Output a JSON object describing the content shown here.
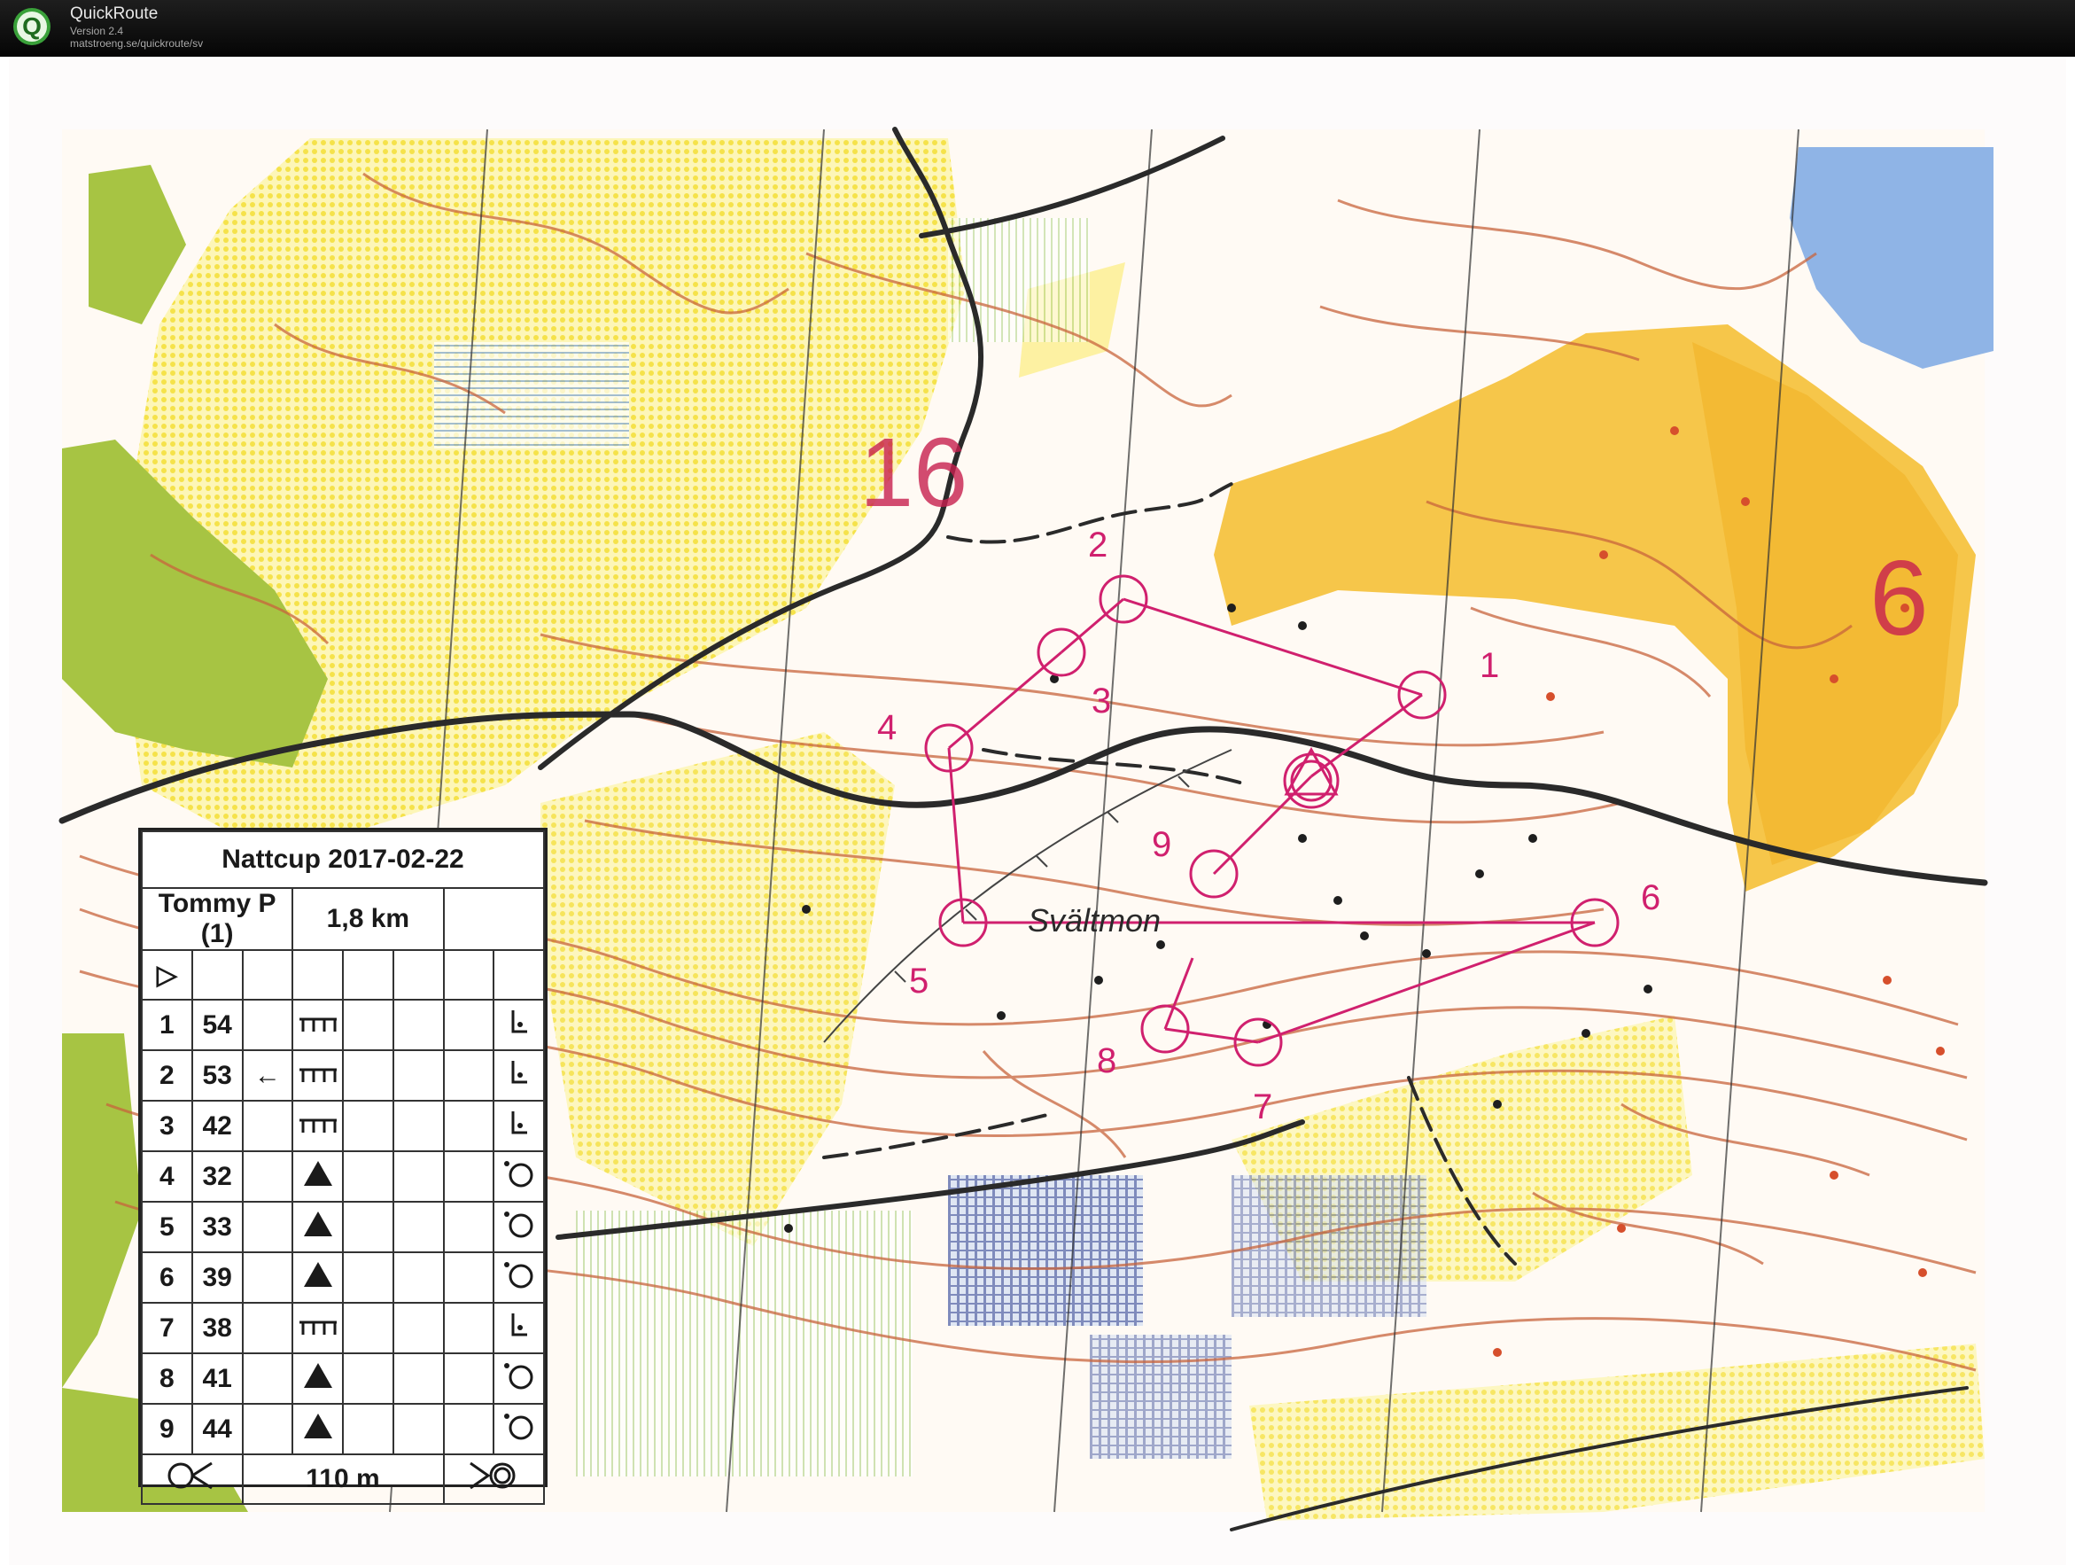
{
  "window": {
    "app_title": "QuickRoute",
    "version": "Version 2.4",
    "url": "matstroeng.se/quickroute/sv",
    "logo_letter": "Q"
  },
  "map": {
    "place_name": "Svältmon",
    "large_number_16": "16",
    "large_number_6": "6",
    "control_labels": [
      "1",
      "2",
      "3",
      "4",
      "5",
      "6",
      "7",
      "8",
      "9"
    ],
    "colors": {
      "course": "#d0206e",
      "contour": "#c8643c",
      "open_yellow": "#f7e870",
      "rough_open": "#f4e69a",
      "orange_field": "#f3b72e",
      "green": "#9bbd3a",
      "water": "#8fb4e6",
      "road": "#2a2a2a"
    }
  },
  "description_sheet": {
    "title": "Nattcup 2017-02-22",
    "runner": "Tommy P (1)",
    "length": "1,8 km",
    "start_symbol": "▷",
    "rows": [
      {
        "num": "1",
        "code": "54",
        "direction": "",
        "feature": "rock-pile",
        "detail": "corner"
      },
      {
        "num": "2",
        "code": "53",
        "direction": "←",
        "feature": "rock-pile",
        "detail": "corner"
      },
      {
        "num": "3",
        "code": "42",
        "direction": "",
        "feature": "rock-pile",
        "detail": "corner"
      },
      {
        "num": "4",
        "code": "32",
        "direction": "",
        "feature": "boulder",
        "detail": "circle"
      },
      {
        "num": "5",
        "code": "33",
        "direction": "",
        "feature": "boulder",
        "detail": "circle"
      },
      {
        "num": "6",
        "code": "39",
        "direction": "",
        "feature": "boulder",
        "detail": "circle"
      },
      {
        "num": "7",
        "code": "38",
        "direction": "",
        "feature": "rock-pile",
        "detail": "corner"
      },
      {
        "num": "8",
        "code": "41",
        "direction": "",
        "feature": "boulder",
        "detail": "circle"
      },
      {
        "num": "9",
        "code": "44",
        "direction": "",
        "feature": "boulder",
        "detail": "circle"
      }
    ],
    "finish_distance": "110 m"
  }
}
